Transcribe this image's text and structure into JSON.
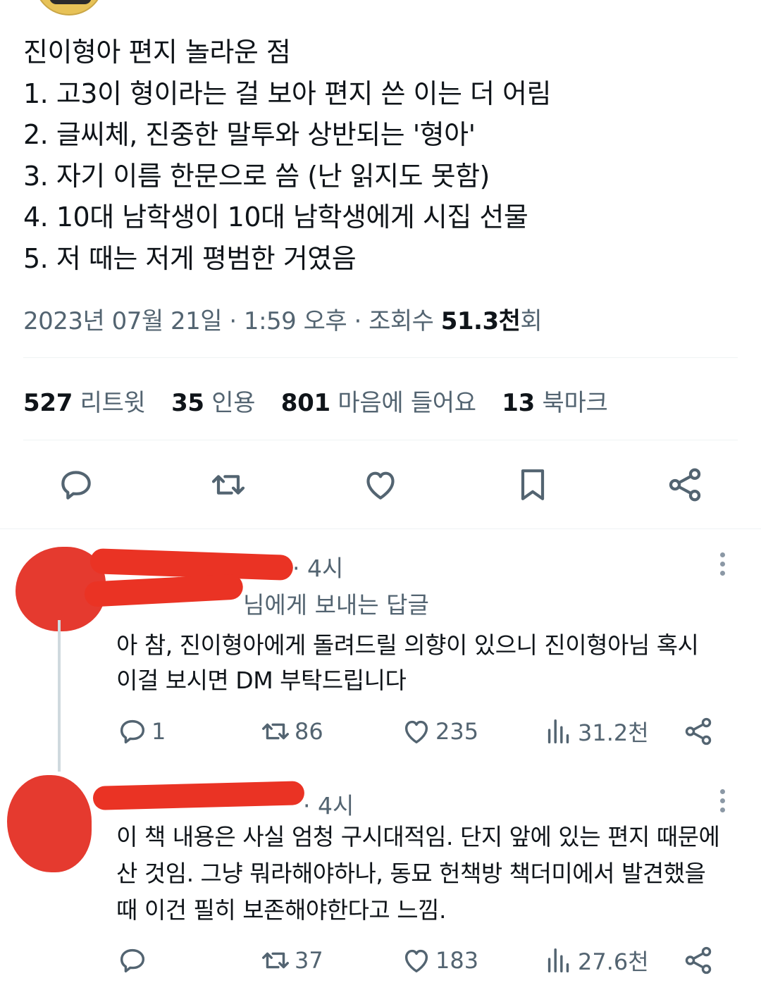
{
  "tweet": {
    "lines": [
      "진이형아 편지 놀라운 점",
      "1. 고3이 형이라는 걸 보아 편지 쓴 이는 더 어림",
      "2. 글씨체, 진중한 말투와 상반되는 '형아'",
      "3. 자기 이름 한문으로 씀 (난 읽지도 못함)",
      "4. 10대 남학생이 10대 남학생에게 시집 선물",
      "5. 저 때는 저게 평범한 거였음"
    ],
    "meta": {
      "date": "2023년 07월 21일 · 1:59 오후 · 조회수 ",
      "views_num": "51.3천",
      "views_suffix": "회"
    },
    "stats": [
      {
        "num": "527",
        "label": "리트윗"
      },
      {
        "num": "35",
        "label": "인용"
      },
      {
        "num": "801",
        "label": "마음에 들어요"
      },
      {
        "num": "13",
        "label": "북마크"
      }
    ],
    "actions": [
      "reply-icon",
      "retweet-icon",
      "like-icon",
      "bookmark-icon",
      "share-icon"
    ]
  },
  "replies": [
    {
      "time": "· 4시",
      "replying_to_suffix": "님에게 보내는 답글",
      "text_lines": [
        "아 참, 진이형아에게 돌려드릴 의향이 있으니 진이형아님 혹시",
        "이걸 보시면 DM 부탁드립니다"
      ],
      "counts": {
        "replies": "1",
        "retweets": "86",
        "likes": "235",
        "views": "31.2천"
      }
    },
    {
      "time": "· 4시",
      "text_lines": [
        "이 책 내용은 사실 엄청 구시대적임. 단지 앞에 있는 편지 때문에",
        "산 것임. 그냥 뭐라해야하나, 동묘 헌책방 책더미에서 발견했을",
        "때 이건 필히 보존해야한다고 느낌."
      ],
      "counts": {
        "replies": "",
        "retweets": "37",
        "likes": "183",
        "views": "27.6천"
      }
    }
  ],
  "colors": {
    "text": "#0f1419",
    "muted": "#536471",
    "link": "#1d9bf0",
    "redaction": "#ea3324"
  }
}
